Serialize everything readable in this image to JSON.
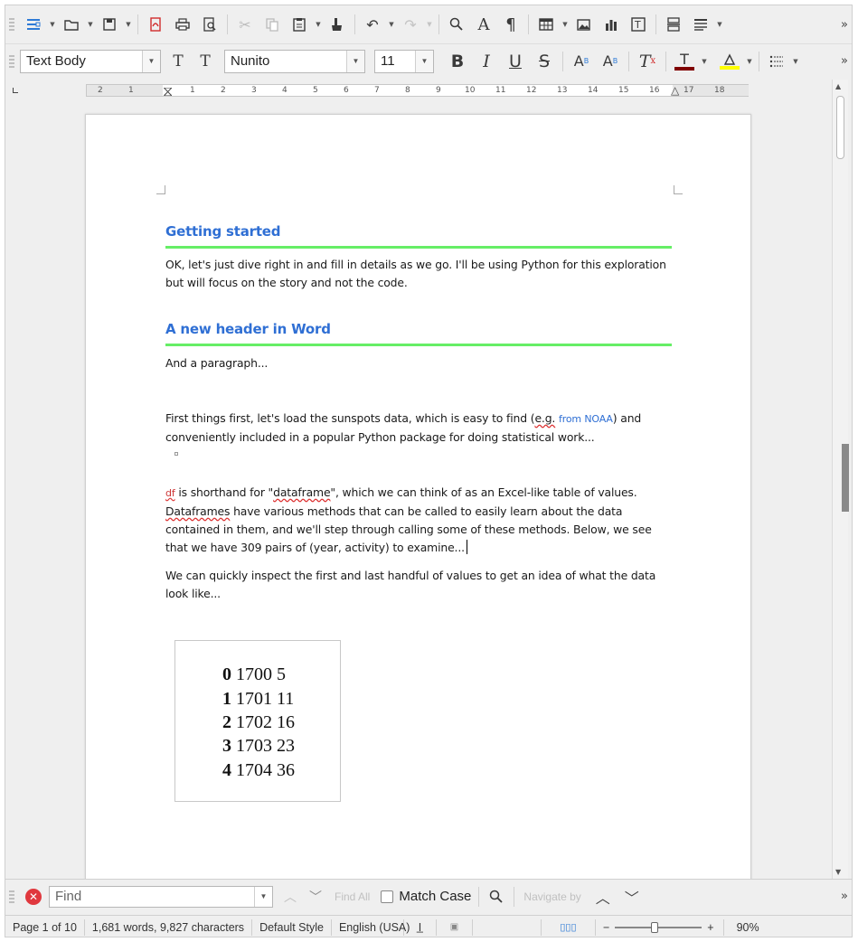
{
  "toolbar": {
    "style_value": "Text Body",
    "font_value": "Nunito",
    "size_value": "11",
    "bold_label": "B",
    "italic_label": "I",
    "underline_label": "U",
    "strike_label": "S",
    "super_label": "A",
    "sub_label": "A",
    "clear_label": "T",
    "more_label": "»",
    "font_color": "#800000",
    "highlight_color": "#ffff00"
  },
  "ruler": {
    "ticks": [
      "2",
      "1",
      "1",
      "2",
      "3",
      "4",
      "5",
      "6",
      "7",
      "8",
      "9",
      "10",
      "11",
      "12",
      "13",
      "14",
      "15",
      "16",
      "17",
      "18"
    ]
  },
  "document": {
    "heading1": "Getting started",
    "para1": "OK, let's just dive right in and fill in details as we go. I'll be using Python for this exploration but will focus on the story and not the code.",
    "heading2": "A new header in Word",
    "para2": "And a paragraph...",
    "para3_a": "First things first, let's load the sunspots data, which is easy to find (",
    "para3_eg": "e.g.",
    "para3_link": "from NOAA",
    "para3_b": ") and conveniently included in a popular Python package for doing statistical work...",
    "para4_df": "df",
    "para4_a": " is shorthand for \"",
    "para4_dataframe": "dataframe",
    "para4_b": "\", which we can think of as an Excel-like table of values. ",
    "para4_dataframes": "Dataframes",
    "para4_c": " have various methods that can be called to easily learn about the data contained in them, and we'll step through calling some of these methods. Below, we see that we have 309 pairs of (year, activity) to examine...",
    "para5": "We can quickly inspect the first and last handful of values to get an idea of what the data look like...",
    "table_rows": [
      {
        "idx": "0",
        "year": "1700",
        "val": "5"
      },
      {
        "idx": "1",
        "year": "1701",
        "val": "11"
      },
      {
        "idx": "2",
        "year": "1702",
        "val": "16"
      },
      {
        "idx": "3",
        "year": "1703",
        "val": "23"
      },
      {
        "idx": "4",
        "year": "1704",
        "val": "36"
      }
    ]
  },
  "findbar": {
    "placeholder": "Find",
    "find_all": "Find All",
    "match_case": "Match Case",
    "navigate_by": "Navigate by",
    "more_label": "»"
  },
  "status": {
    "page": "Page 1 of 10",
    "words": "1,681 words, 9,827 characters",
    "style": "Default Style",
    "language": "English (USA)",
    "zoom_minus": "−",
    "zoom_plus": "+",
    "zoom": "90%"
  },
  "colors": {
    "heading": "#2f6fd4",
    "heading_rule": "#66ee66",
    "close_button": "#e0383e"
  }
}
